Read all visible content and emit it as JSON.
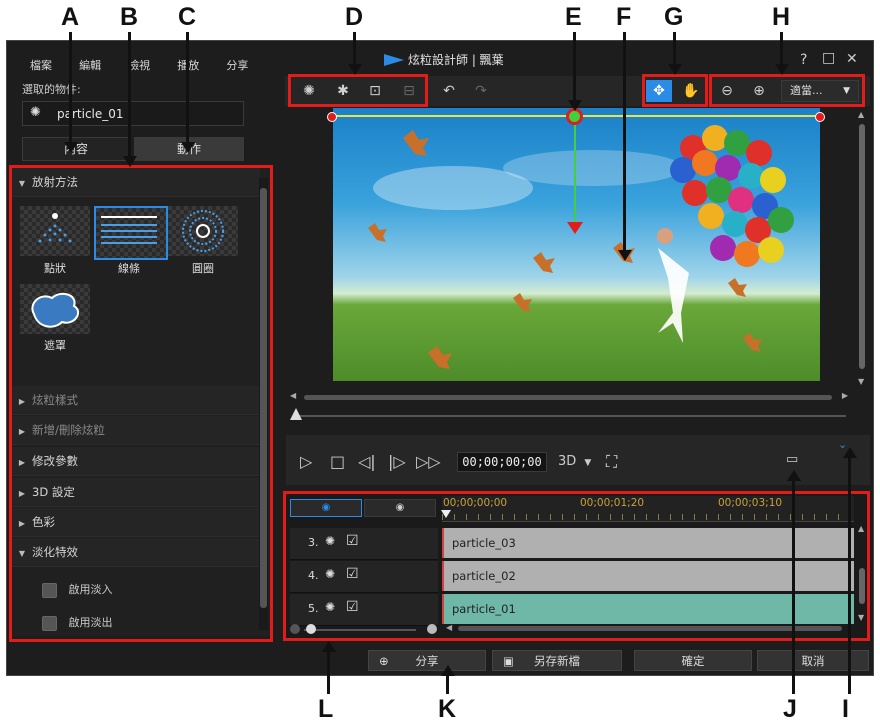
{
  "callouts": {
    "a": "A",
    "b": "B",
    "c": "C",
    "d": "D",
    "e": "E",
    "f": "F",
    "g": "G",
    "h": "H",
    "i": "I",
    "j": "J",
    "k": "K",
    "l": "L"
  },
  "window": {
    "title": "炫粒設計師 | 飄葉",
    "menu": [
      "檔案",
      "編輯",
      "檢視",
      "播放",
      "分享"
    ],
    "controls": {
      "help": "?",
      "maximize": "□",
      "close": "✕"
    }
  },
  "left_panel": {
    "selected_object_label": "選取的物件:",
    "selected_object": "particle_01",
    "tabs": [
      {
        "label": "內容"
      },
      {
        "label": "動作"
      }
    ],
    "emit_section": "放射方法",
    "emit_options": [
      {
        "label": "點狀",
        "icon": "point-emitter-icon"
      },
      {
        "label": "線條",
        "icon": "line-emitter-icon",
        "selected": true
      },
      {
        "label": "圓圈",
        "icon": "circle-emitter-icon"
      },
      {
        "label": "遮罩",
        "icon": "mask-emitter-icon"
      }
    ],
    "sections": [
      {
        "label": "炫粒樣式",
        "dim": true
      },
      {
        "label": "新增/刪除炫粒",
        "dim": true
      },
      {
        "label": "修改參數",
        "dim": false
      },
      {
        "label": "3D 設定",
        "dim": false
      },
      {
        "label": "色彩",
        "dim": false
      }
    ],
    "fade_section": "淡化特效",
    "fade_options": [
      {
        "label": "啟用淡入"
      },
      {
        "label": "啟用淡出"
      }
    ]
  },
  "toolbar": {
    "zoom_select": "適當..."
  },
  "player": {
    "timecode": "00;00;00;00",
    "mode_3d": "3D"
  },
  "timeline": {
    "ruler": [
      "00;00;00;00",
      "00;00;01;20",
      "00;00;03;10"
    ],
    "tracks": [
      {
        "num": "3.",
        "name": "particle_03",
        "checked": "☑"
      },
      {
        "num": "4.",
        "name": "particle_02",
        "checked": "☑"
      },
      {
        "num": "5.",
        "name": "particle_01",
        "checked": "☑"
      }
    ]
  },
  "buttons": {
    "share": "分享",
    "save_as": "另存新檔",
    "ok": "確定",
    "cancel": "取消"
  },
  "colors": {
    "highlight_red": "#e21b1b",
    "selected_blue": "#2a8ce6",
    "guide_yellow": "#f0e040",
    "guide_green": "#40d040",
    "clip_selected": "#6fb8a8"
  }
}
